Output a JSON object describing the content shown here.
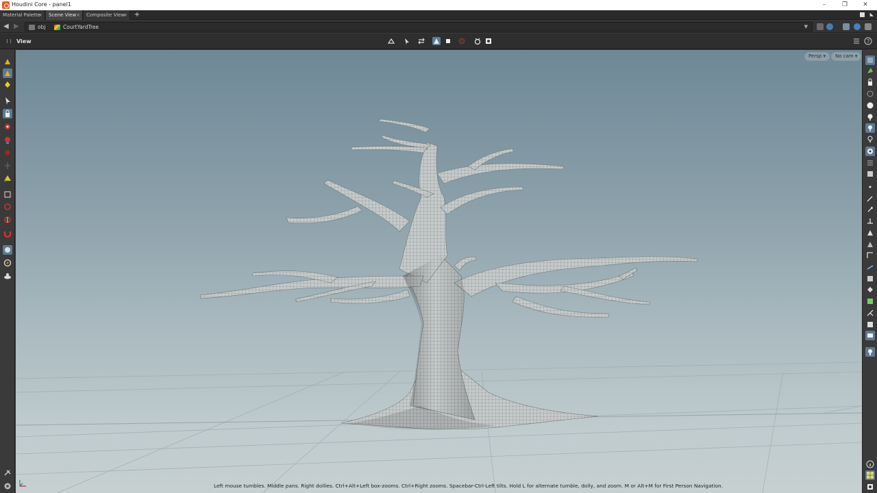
{
  "window": {
    "title": "Houdini Core - panel1"
  },
  "window_controls": {
    "minimize": "–",
    "restore": "❐",
    "close": "✕"
  },
  "tabs": [
    {
      "label": "Material Palette",
      "active": false
    },
    {
      "label": "Scene View",
      "active": true
    },
    {
      "label": "Composite View",
      "active": false
    }
  ],
  "tab_close_glyph": "×",
  "tab_add_glyph": "+",
  "path": {
    "back_glyph": "◀",
    "forward_glyph": "▶",
    "crumbs": [
      "obj",
      "CourtYardTree"
    ]
  },
  "pane": {
    "title": "View"
  },
  "viewport": {
    "camera_menu": "Persp ▾",
    "cam_menu": "No cam ▾",
    "hint": "Left mouse tumbles. Middle pans. Right dollies. Ctrl+Alt+Left box-zooms. Ctrl+Right zooms. Spacebar-Ctrl-Left tilts. Hold L for alternate tumble, dolly, and zoom.     M or Alt+M for First Person Navigation."
  },
  "colors": {
    "accent": "#5b7a94",
    "app_icon": "#f05a22",
    "tree_surface": "#c9cdcd",
    "wire": "#6f7878"
  },
  "icons": {
    "left": [
      "select-obj-icon",
      "select-geo-icon",
      "select-lights-icon",
      "arrow-select-icon",
      "lock-icon",
      "move-icon",
      "rotate-icon",
      "scale-icon",
      "pose-icon",
      "handle-icon",
      "view-tool-icon",
      "brush-icon",
      "orient-icon",
      "magnet-icon",
      "snap-icon",
      "grid-snap-icon",
      "render-region-icon",
      "pin-icon",
      "camera-icon"
    ],
    "right": [
      "display-options-icon",
      "lock-camera-icon",
      "sphere-icon",
      "wireframe-icon",
      "light-icon",
      "headlight-icon",
      "ghost-icon",
      "shading-icon",
      "point-icon",
      "normal-icon",
      "vertex-icon",
      "edge-icon",
      "face-icon",
      "bbox-icon",
      "template-icon",
      "guide-icon",
      "layout-icon",
      "info-icon",
      "background-icon",
      "render-icon"
    ]
  }
}
